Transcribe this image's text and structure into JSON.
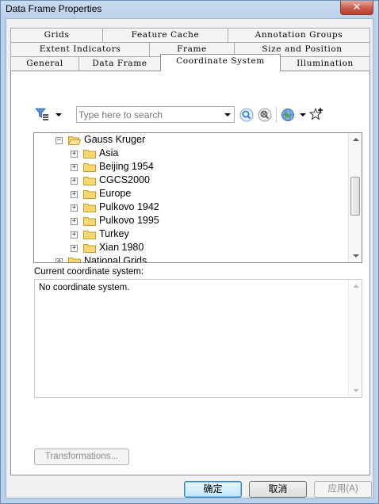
{
  "window": {
    "title": "Data Frame Properties",
    "close_label": "✕"
  },
  "tabs": {
    "row1": [
      "Grids",
      "Feature Cache",
      "Annotation Groups"
    ],
    "row2": [
      "Extent Indicators",
      "Frame",
      "Size and Position"
    ],
    "row3": [
      "General",
      "Data Frame",
      "Coordinate System",
      "Illumination"
    ],
    "active": "Coordinate System"
  },
  "toolbar": {
    "filter_icon": "filter-icon",
    "search_placeholder": "Type here to search",
    "search_value": "",
    "search_go_icon": "search-icon",
    "clear_search_icon": "clear-search-icon",
    "globe_icon": "globe-icon",
    "favorites_icon": "add-favorite-icon"
  },
  "tree": {
    "parent": {
      "label": "Gauss Kruger",
      "expanded": true
    },
    "children": [
      "Asia",
      "Beijing 1954",
      "CGCS2000",
      "Europe",
      "Pulkovo 1942",
      "Pulkovo 1995",
      "Turkey",
      "Xian 1980"
    ],
    "next_sibling": {
      "label": "National Grids",
      "expanded": false
    }
  },
  "current": {
    "label": "Current coordinate system:",
    "value": "No coordinate system."
  },
  "buttons": {
    "transformations": "Transformations...",
    "ok": "确定",
    "cancel": "取消",
    "apply": "应用(A)"
  },
  "colors": {
    "window_frame": "#b9d1ea",
    "folder_fill": "#f6d66e",
    "folder_stroke": "#c79a2d",
    "search_go": "#2f7fd8"
  }
}
